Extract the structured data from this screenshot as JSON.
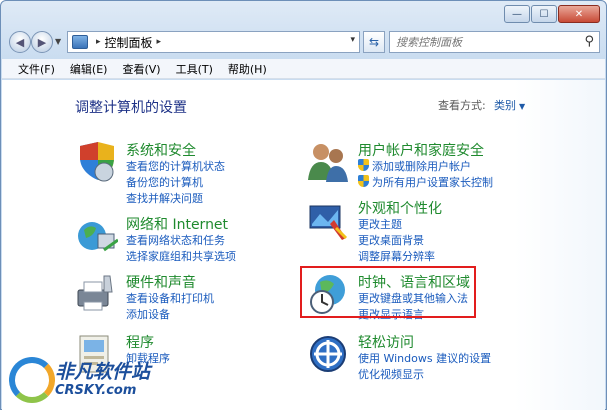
{
  "window": {
    "minimize": "—",
    "maximize": "☐",
    "close": "✕"
  },
  "address": {
    "crumb": "控制面板",
    "separator": "▸",
    "dropdown": "▾"
  },
  "search": {
    "placeholder": "搜索控制面板"
  },
  "menu": [
    "文件(F)",
    "编辑(E)",
    "查看(V)",
    "工具(T)",
    "帮助(H)"
  ],
  "heading": "调整计算机的设置",
  "view": {
    "label": "查看方式:",
    "value": "类别"
  },
  "categories": [
    {
      "title": "系统和安全",
      "links": [
        "查看您的计算机状态",
        "备份您的计算机",
        "查找并解决问题"
      ]
    },
    {
      "title": "网络和 Internet",
      "links": [
        "查看网络状态和任务",
        "选择家庭组和共享选项"
      ]
    },
    {
      "title": "硬件和声音",
      "links": [
        "查看设备和打印机",
        "添加设备"
      ]
    },
    {
      "title": "程序",
      "links": [
        "卸载程序"
      ]
    },
    {
      "title": "用户帐户和家庭安全",
      "links": [
        "添加或删除用户帐户",
        "为所有用户设置家长控制"
      ]
    },
    {
      "title": "外观和个性化",
      "links": [
        "更改主题",
        "更改桌面背景",
        "调整屏幕分辨率"
      ]
    },
    {
      "title": "时钟、语言和区域",
      "links": [
        "更改键盘或其他输入法",
        "更改显示语言"
      ]
    },
    {
      "title": "轻松访问",
      "links": [
        "使用 Windows 建议的设置",
        "优化视频显示"
      ]
    }
  ],
  "watermark": {
    "cn": "非凡软件站",
    "en": "CRSKY.com"
  },
  "colors": {
    "title_green": "#1f8a2e",
    "link_blue": "#1a5bbd",
    "highlight_red": "#e21d1d"
  }
}
